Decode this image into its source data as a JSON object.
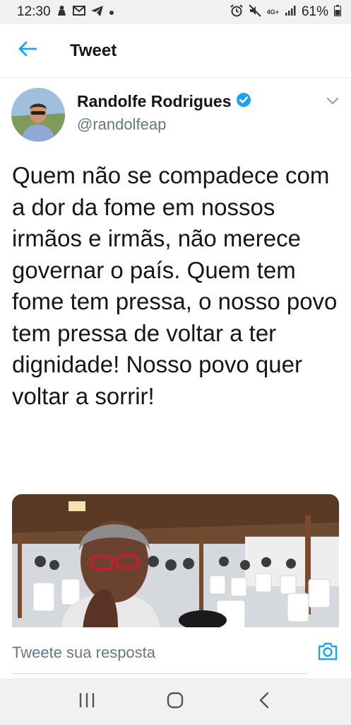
{
  "status_bar": {
    "time": "12:30",
    "network_label": "4G+",
    "battery": "61%"
  },
  "header": {
    "title": "Tweet"
  },
  "tweet": {
    "author_name": "Randolfe Rodrigues",
    "author_handle": "@randolfeap",
    "verified": true,
    "text": "Quem não se compadece com a dor da fome em nossos irmãos e irmãs, não merece governar o país. Quem tem fome tem pressa, o nosso povo tem pressa de voltar a ter dignidade! Nosso povo quer voltar a sorrir!"
  },
  "reply": {
    "placeholder": "Tweete sua resposta"
  },
  "colors": {
    "accent": "#1da1f2",
    "text": "#14171a",
    "muted": "#657786"
  },
  "icons": {
    "back": "arrow-left-icon",
    "verified": "verified-badge-icon",
    "more": "chevron-down-icon",
    "camera": "camera-icon",
    "nav_recent": "recent-apps-icon",
    "nav_home": "home-icon",
    "nav_back": "back-icon"
  }
}
